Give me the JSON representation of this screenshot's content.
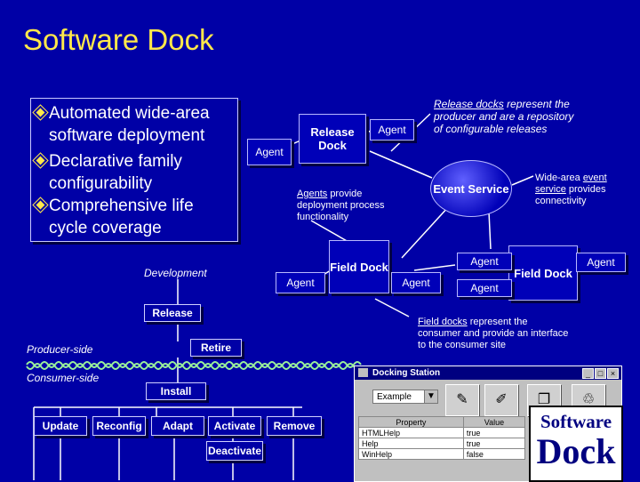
{
  "title": "Software Dock",
  "bullets": [
    "Automated wide-area software deployment",
    "Declarative family configurability",
    "Comprehensive life cycle coverage"
  ],
  "diagram": {
    "release_dock": "Release Dock",
    "field_dock": "Field Dock",
    "field_dock_right": "Field Dock",
    "event_service": "Event Service",
    "agent": "Agent",
    "release_note_link": "Release docks",
    "release_note_rest": "represent the producer and are a repository of configurable releases",
    "agents_note_link": "Agents",
    "agents_note_rest": "provide deployment process functionality",
    "event_note_prefix": "Wide-area",
    "event_note_link": "event service",
    "event_note_rest": "provides connectivity",
    "field_note_link": "Field docks",
    "field_note_rest": "represent the consumer and provide an interface to the consumer site"
  },
  "lifecycle": {
    "development": "Development",
    "release": "Release",
    "retire": "Retire",
    "producer_side": "Producer-side",
    "consumer_side": "Consumer-side",
    "install": "Install",
    "update": "Update",
    "reconfig": "Reconfig",
    "adapt": "Adapt",
    "activate": "Activate",
    "remove": "Remove",
    "deactivate": "Deactivate"
  },
  "window": {
    "title": "Docking Station",
    "dropdown": "Example",
    "table_headers": [
      "Property",
      "Value"
    ],
    "rows": [
      [
        "HTMLHelp",
        "true"
      ],
      [
        "Help",
        "true"
      ],
      [
        "WinHelp",
        "false"
      ]
    ],
    "logo_top": "Software",
    "logo_bottom": "Dock"
  }
}
